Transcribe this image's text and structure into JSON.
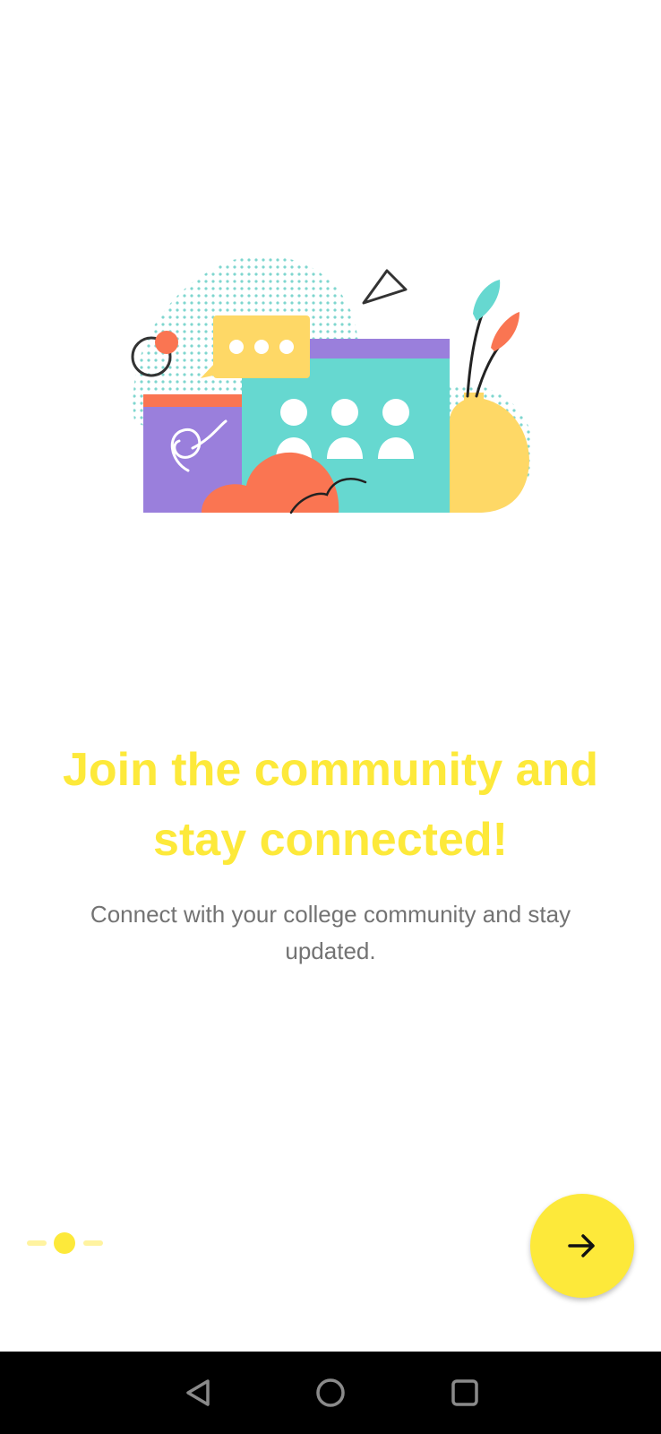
{
  "onboarding": {
    "headline": "Join the community and stay connected!",
    "subtitle": "Connect with your college community and stay updated.",
    "current_page": 2,
    "total_pages": 3
  },
  "colors": {
    "accent": "#fde93a",
    "accent_light": "#fff3a0",
    "subtitle_text": "#737373",
    "illustration_teal": "#66d8d0",
    "illustration_purple": "#9a7fdc",
    "illustration_orange": "#fa7552",
    "illustration_yellow": "#fed866"
  },
  "icons": {
    "next": "arrow-right-icon",
    "illustration": "community-illustration-icon",
    "nav_back": "triangle-back-icon",
    "nav_home": "circle-home-icon",
    "nav_recent": "square-recents-icon"
  }
}
